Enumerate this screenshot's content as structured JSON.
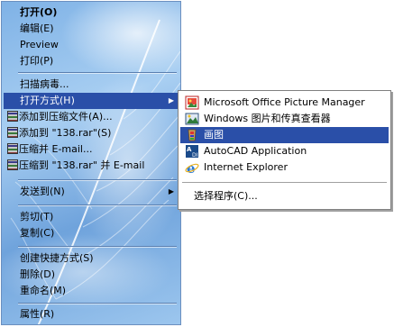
{
  "context_menu": {
    "items": [
      {
        "label": "打开(O)",
        "bold": true
      },
      {
        "label": "编辑(E)"
      },
      {
        "label": "Preview"
      },
      {
        "label": "打印(P)"
      },
      {
        "label": "扫描病毒..."
      },
      {
        "label": "打开方式(H)",
        "selected": true,
        "has_submenu": true
      },
      {
        "label": "添加到压缩文件(A)...",
        "icon": "winrar-icon"
      },
      {
        "label": "添加到 \"138.rar\"(S)",
        "icon": "winrar-icon"
      },
      {
        "label": "压缩并 E-mail...",
        "icon": "winrar-icon"
      },
      {
        "label": "压缩到 \"138.rar\" 并 E-mail",
        "icon": "winrar-icon"
      },
      {
        "label": "发送到(N)",
        "has_submenu": true
      },
      {
        "label": "剪切(T)"
      },
      {
        "label": "复制(C)"
      },
      {
        "label": "创建快捷方式(S)"
      },
      {
        "label": "删除(D)"
      },
      {
        "label": "重命名(M)"
      },
      {
        "label": "属性(R)"
      }
    ]
  },
  "open_with_submenu": {
    "items": [
      {
        "label": "Microsoft Office Picture Manager",
        "icon": "picture-manager-icon"
      },
      {
        "label": "Windows 图片和传真查看器",
        "icon": "image-viewer-icon"
      },
      {
        "label": "画图",
        "icon": "paint-icon",
        "selected": true
      },
      {
        "label": "AutoCAD Application",
        "icon": "autocad-icon"
      },
      {
        "label": "Internet Explorer",
        "icon": "internet-explorer-icon"
      }
    ],
    "choose_program": "选择程序(C)..."
  },
  "colors": {
    "highlight": "#2a4fa8",
    "menu_background": "#8fbfee"
  }
}
